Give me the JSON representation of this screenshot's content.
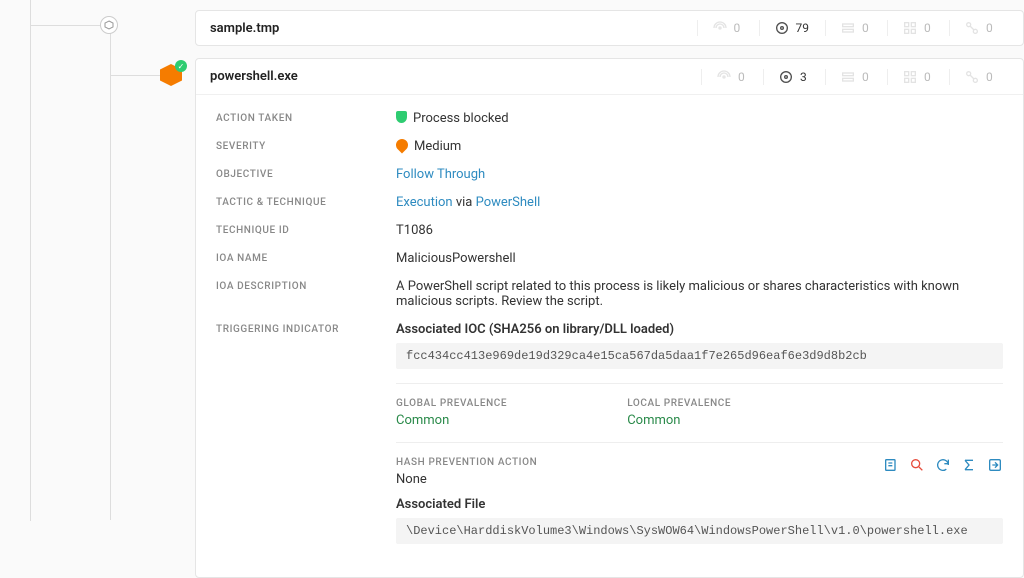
{
  "rows": {
    "parent": {
      "name": "sample.tmp",
      "stats": {
        "network": "0",
        "disk": "79",
        "registry": "0",
        "process": "0",
        "dns": "0"
      }
    },
    "child": {
      "name": "powershell.exe",
      "stats": {
        "network": "0",
        "disk": "3",
        "registry": "0",
        "process": "0",
        "dns": "0"
      }
    }
  },
  "fields": {
    "action_taken": {
      "label": "ACTION TAKEN",
      "value": "Process blocked"
    },
    "severity": {
      "label": "SEVERITY",
      "value": "Medium"
    },
    "objective": {
      "label": "OBJECTIVE",
      "link": "Follow Through"
    },
    "tactic_technique": {
      "label": "TACTIC & TECHNIQUE",
      "link1": "Execution",
      "via": " via ",
      "link2": "PowerShell"
    },
    "technique_id": {
      "label": "TECHNIQUE ID",
      "value": "T1086"
    },
    "ioa_name": {
      "label": "IOA NAME",
      "value": "MaliciousPowershell"
    },
    "ioa_description": {
      "label": "IOA DESCRIPTION",
      "value": "A PowerShell script related to this process is likely malicious or shares characteristics with known malicious scripts. Review the script."
    },
    "triggering_indicator": {
      "label": "TRIGGERING INDICATOR",
      "title": "Associated IOC (SHA256 on library/DLL loaded)",
      "hash": "fcc434cc413e969de19d329ca4e15ca567da5daa1f7e265d96eaf6e3d9d8b2cb"
    }
  },
  "prevalence": {
    "global": {
      "label": "GLOBAL PREVALENCE",
      "value": "Common"
    },
    "local": {
      "label": "LOCAL PREVALENCE",
      "value": "Common"
    }
  },
  "hash_prevention": {
    "label": "HASH PREVENTION ACTION",
    "value": "None"
  },
  "associated_file": {
    "title": "Associated File",
    "path": "\\Device\\HarddiskVolume3\\Windows\\SysWOW64\\WindowsPowerShell\\v1.0\\powershell.exe"
  }
}
